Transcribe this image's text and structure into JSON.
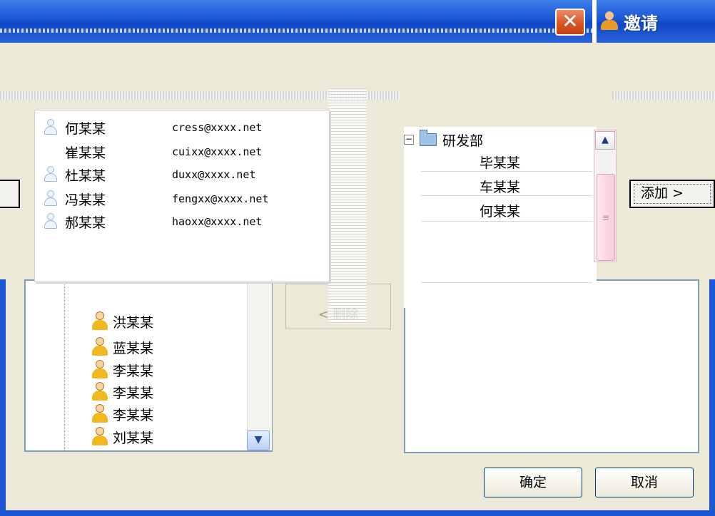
{
  "title_bar": {
    "close_glyph": "✕",
    "invite_label": "邀请"
  },
  "popup": {
    "contacts": [
      {
        "name": "何某某",
        "email": "cress@xxxx.net"
      },
      {
        "name": "崔某某",
        "email": "cuixx@xxxx.net"
      },
      {
        "name": "杜某某",
        "email": "duxx@xxxx.net"
      },
      {
        "name": "冯某某",
        "email": "fengxx@xxxx.net"
      },
      {
        "name": "郝某某",
        "email": "haoxx@xxxx.net"
      }
    ]
  },
  "left_tree": {
    "items": [
      "洪某某",
      "蓝某某",
      "李某某",
      "李某某",
      "李某某",
      "刘某某"
    ]
  },
  "delete_button": {
    "label": "< 删除"
  },
  "org_tree": {
    "root_label": "研发部",
    "children": [
      "毕某某",
      "车某某",
      "何某某"
    ]
  },
  "add_button": {
    "label": "添加 >"
  },
  "footer": {
    "ok_label": "确定",
    "cancel_label": "取消"
  },
  "colors": {
    "titlebar": "#1c56d4",
    "close_button": "#d7521f",
    "panel": "#ece9d8"
  }
}
